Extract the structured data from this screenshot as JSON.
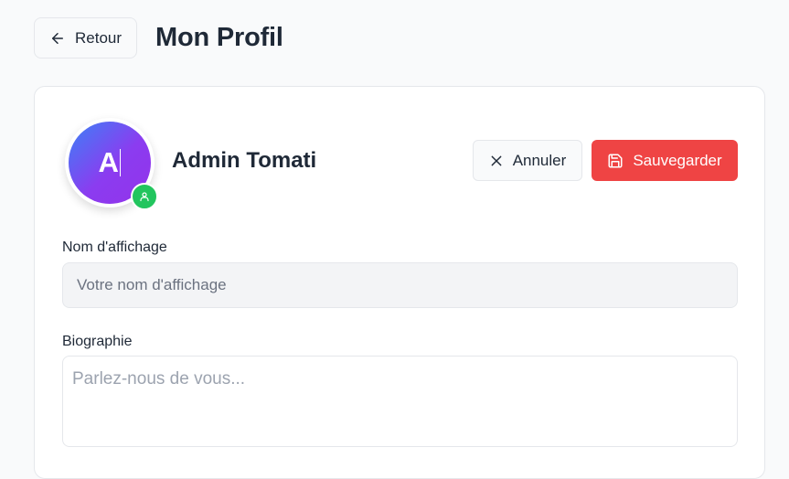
{
  "header": {
    "back_label": "Retour",
    "title": "Mon Profil"
  },
  "profile": {
    "avatar_initial": "A",
    "display_name": "Admin Tomati",
    "role_badge_icon": "user-icon",
    "avatar_gradient": [
      "#3b82f6",
      "#9333ea"
    ],
    "badge_color": "#22c55e"
  },
  "actions": {
    "cancel_label": "Annuler",
    "save_label": "Sauvegarder",
    "save_color": "#ef4444"
  },
  "form": {
    "display_name_label": "Nom d'affichage",
    "display_name_value": "",
    "display_name_placeholder": "Votre nom d'affichage",
    "bio_label": "Biographie",
    "bio_value": "",
    "bio_placeholder": "Parlez-nous de vous..."
  }
}
